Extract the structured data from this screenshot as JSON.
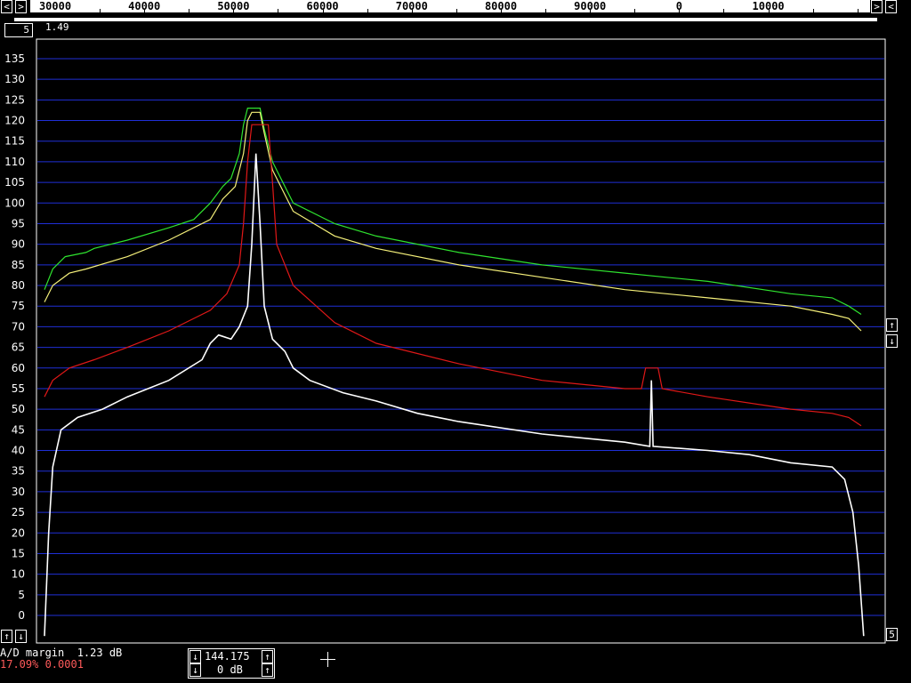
{
  "top_bar": {
    "left_button": "<",
    "right_button_1": ">",
    "right_button_2": "<",
    "left_small_button": ">",
    "freq_labels": [
      "30000",
      "40000",
      "50000",
      "60000",
      "70000",
      "80000",
      "90000",
      "0",
      "10000"
    ]
  },
  "scale_readout": {
    "number": "5",
    "value": "1.49"
  },
  "chart_data": {
    "type": "line",
    "y_ticks": [
      135,
      130,
      125,
      120,
      115,
      110,
      105,
      100,
      95,
      90,
      85,
      80,
      75,
      70,
      65,
      60,
      55,
      50,
      45,
      40,
      35,
      30,
      25,
      20,
      15,
      10,
      5,
      0
    ],
    "ylim": [
      -5,
      137
    ],
    "grid": true,
    "colors": {
      "grid": "#1f2fd6",
      "green": "#2fe32f",
      "yellow": "#f5f07a",
      "red": "#e01818",
      "white": "#ffffff"
    },
    "series": [
      {
        "color": "#2fe32f",
        "points": [
          [
            0,
            79
          ],
          [
            0.01,
            84
          ],
          [
            0.025,
            87
          ],
          [
            0.05,
            88
          ],
          [
            0.06,
            89
          ],
          [
            0.1,
            91
          ],
          [
            0.15,
            94
          ],
          [
            0.18,
            96
          ],
          [
            0.2,
            100
          ],
          [
            0.215,
            104
          ],
          [
            0.225,
            106
          ],
          [
            0.235,
            112
          ],
          [
            0.24,
            119
          ],
          [
            0.245,
            123
          ],
          [
            0.26,
            123
          ],
          [
            0.265,
            118
          ],
          [
            0.275,
            110
          ],
          [
            0.3,
            100
          ],
          [
            0.35,
            95
          ],
          [
            0.4,
            92
          ],
          [
            0.5,
            88
          ],
          [
            0.6,
            85
          ],
          [
            0.7,
            83
          ],
          [
            0.75,
            82
          ],
          [
            0.8,
            81
          ],
          [
            0.9,
            78
          ],
          [
            0.95,
            77
          ],
          [
            0.97,
            75
          ],
          [
            0.985,
            73
          ]
        ]
      },
      {
        "color": "#f5f07a",
        "points": [
          [
            0,
            76
          ],
          [
            0.01,
            80
          ],
          [
            0.03,
            83
          ],
          [
            0.05,
            84
          ],
          [
            0.1,
            87
          ],
          [
            0.15,
            91
          ],
          [
            0.2,
            96
          ],
          [
            0.215,
            101
          ],
          [
            0.23,
            104
          ],
          [
            0.24,
            112
          ],
          [
            0.245,
            120
          ],
          [
            0.25,
            122
          ],
          [
            0.26,
            122
          ],
          [
            0.265,
            117
          ],
          [
            0.275,
            108
          ],
          [
            0.3,
            98
          ],
          [
            0.35,
            92
          ],
          [
            0.4,
            89
          ],
          [
            0.5,
            85
          ],
          [
            0.6,
            82
          ],
          [
            0.7,
            79
          ],
          [
            0.8,
            77
          ],
          [
            0.9,
            75
          ],
          [
            0.95,
            73
          ],
          [
            0.97,
            72
          ],
          [
            0.985,
            69
          ]
        ]
      },
      {
        "color": "#e01818",
        "points": [
          [
            0,
            53
          ],
          [
            0.01,
            57
          ],
          [
            0.03,
            60
          ],
          [
            0.06,
            62
          ],
          [
            0.1,
            65
          ],
          [
            0.15,
            69
          ],
          [
            0.2,
            74
          ],
          [
            0.22,
            78
          ],
          [
            0.235,
            85
          ],
          [
            0.24,
            95
          ],
          [
            0.245,
            110
          ],
          [
            0.25,
            119
          ],
          [
            0.27,
            119
          ],
          [
            0.275,
            105
          ],
          [
            0.28,
            90
          ],
          [
            0.3,
            80
          ],
          [
            0.35,
            71
          ],
          [
            0.4,
            66
          ],
          [
            0.5,
            61
          ],
          [
            0.6,
            57
          ],
          [
            0.7,
            55
          ],
          [
            0.72,
            55
          ],
          [
            0.725,
            60
          ],
          [
            0.74,
            60
          ],
          [
            0.745,
            55
          ],
          [
            0.8,
            53
          ],
          [
            0.9,
            50
          ],
          [
            0.95,
            49
          ],
          [
            0.97,
            48
          ],
          [
            0.985,
            46
          ]
        ]
      },
      {
        "color": "#ffffff",
        "points": [
          [
            0,
            -5
          ],
          [
            0.005,
            20
          ],
          [
            0.01,
            36
          ],
          [
            0.02,
            45
          ],
          [
            0.04,
            48
          ],
          [
            0.07,
            50
          ],
          [
            0.1,
            53
          ],
          [
            0.15,
            57
          ],
          [
            0.19,
            62
          ],
          [
            0.2,
            66
          ],
          [
            0.21,
            68
          ],
          [
            0.225,
            67
          ],
          [
            0.235,
            70
          ],
          [
            0.245,
            75
          ],
          [
            0.25,
            90
          ],
          [
            0.255,
            112
          ],
          [
            0.26,
            95
          ],
          [
            0.265,
            75
          ],
          [
            0.275,
            67
          ],
          [
            0.29,
            64
          ],
          [
            0.3,
            60
          ],
          [
            0.32,
            57
          ],
          [
            0.36,
            54
          ],
          [
            0.4,
            52
          ],
          [
            0.45,
            49
          ],
          [
            0.5,
            47
          ],
          [
            0.6,
            44
          ],
          [
            0.7,
            42
          ],
          [
            0.73,
            41
          ],
          [
            0.732,
            57
          ],
          [
            0.734,
            41
          ],
          [
            0.8,
            40
          ],
          [
            0.85,
            39
          ],
          [
            0.9,
            37
          ],
          [
            0.95,
            36
          ],
          [
            0.965,
            33
          ],
          [
            0.975,
            25
          ],
          [
            0.982,
            12
          ],
          [
            0.988,
            -5
          ]
        ]
      }
    ]
  },
  "bottom": {
    "ad_margin": "A/D margin  1.23 dB",
    "status": "17.09% 0.0001",
    "freq_value": "144.175",
    "gain_value": "0 dB",
    "right_label": "5"
  }
}
